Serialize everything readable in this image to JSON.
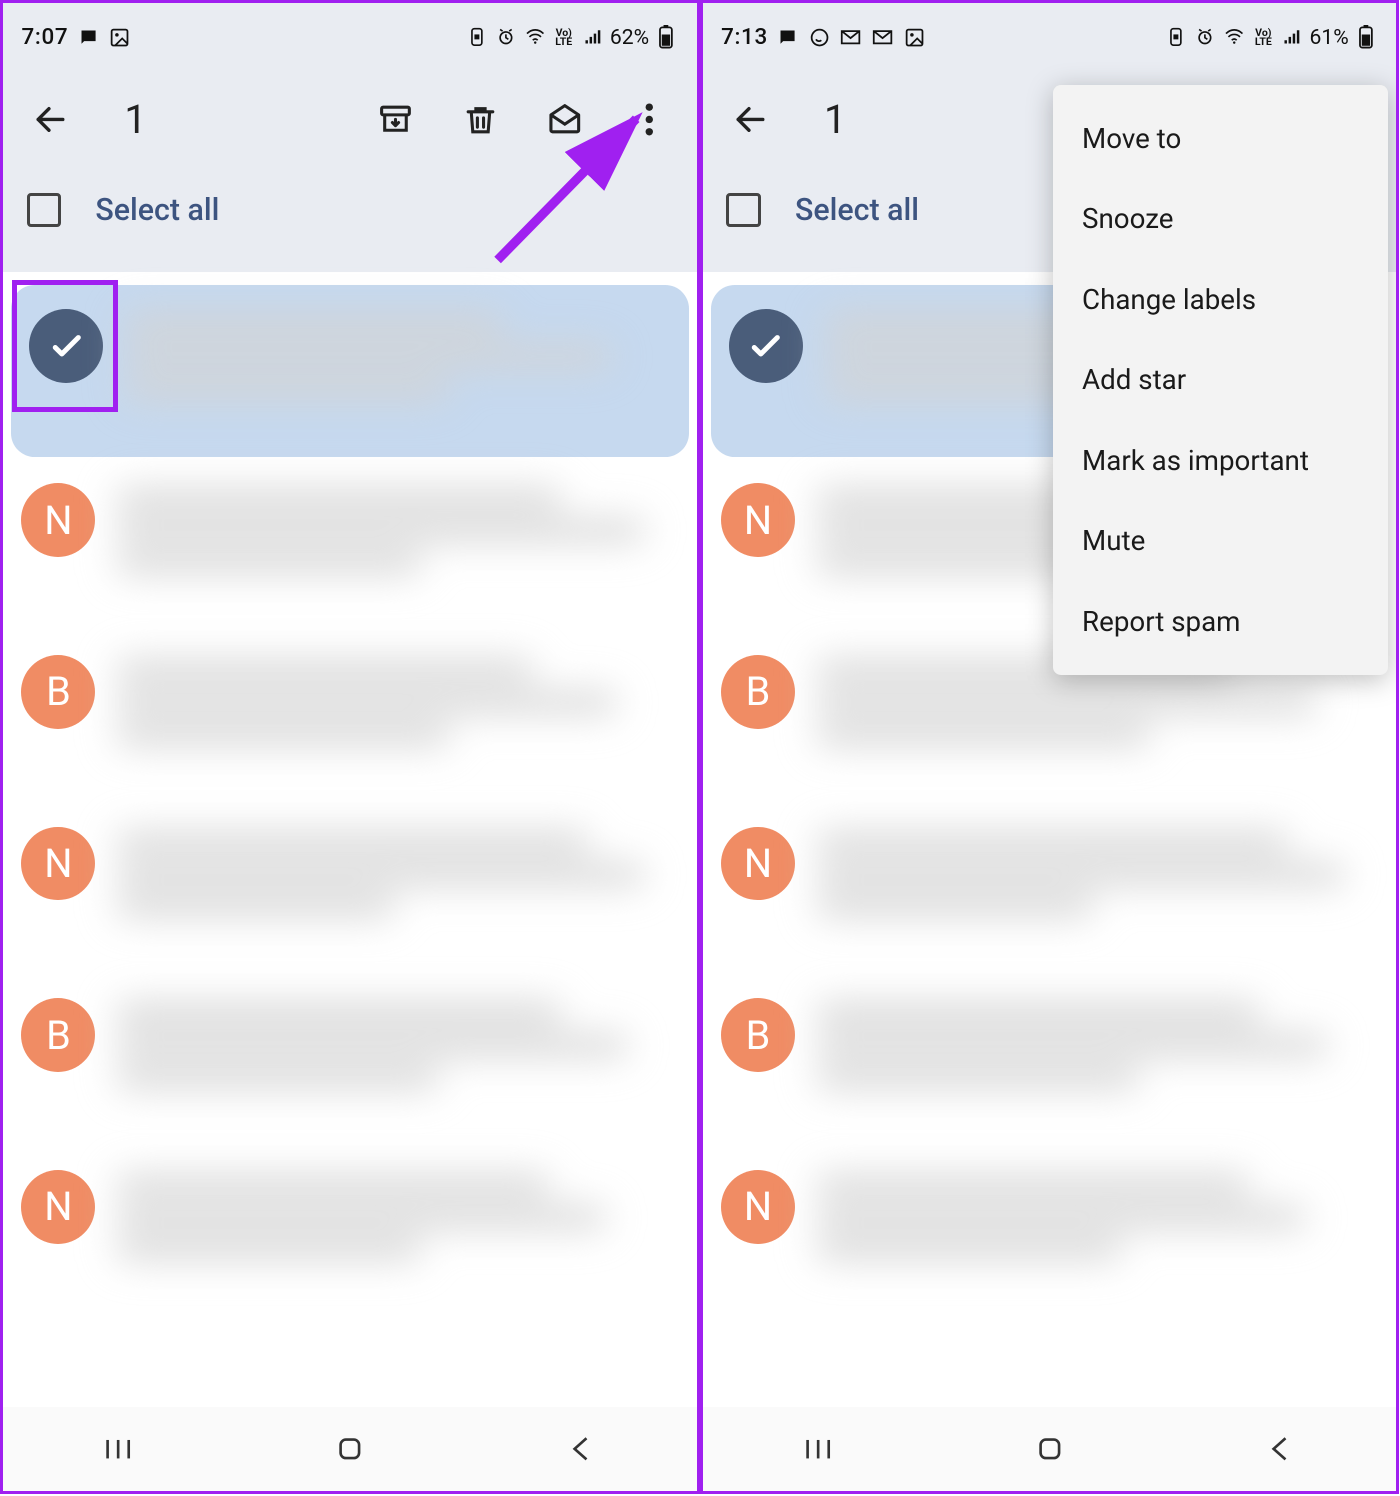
{
  "left": {
    "status": {
      "time": "7:07",
      "battery": "62%"
    },
    "selection_count": "1",
    "select_all": "Select all",
    "rows": [
      {
        "selected": true,
        "avatar": "check",
        "letter": ""
      },
      {
        "selected": false,
        "avatar": "orange",
        "letter": "N"
      },
      {
        "selected": false,
        "avatar": "orange",
        "letter": "B"
      },
      {
        "selected": false,
        "avatar": "orange",
        "letter": "N"
      },
      {
        "selected": false,
        "avatar": "orange",
        "letter": "B"
      },
      {
        "selected": false,
        "avatar": "orange",
        "letter": "N"
      }
    ]
  },
  "right": {
    "status": {
      "time": "7:13",
      "battery": "61%"
    },
    "selection_count": "1",
    "select_all": "Select all",
    "menu": [
      "Move to",
      "Snooze",
      "Change labels",
      "Add star",
      "Mark as important",
      "Mute",
      "Report spam"
    ],
    "rows": [
      {
        "selected": true,
        "avatar": "check",
        "letter": ""
      },
      {
        "selected": false,
        "avatar": "orange",
        "letter": "N"
      },
      {
        "selected": false,
        "avatar": "orange",
        "letter": "B"
      },
      {
        "selected": false,
        "avatar": "orange",
        "letter": "N"
      },
      {
        "selected": false,
        "avatar": "orange",
        "letter": "B"
      },
      {
        "selected": false,
        "avatar": "orange",
        "letter": "N"
      }
    ]
  },
  "annotation_color": "#a020f0"
}
